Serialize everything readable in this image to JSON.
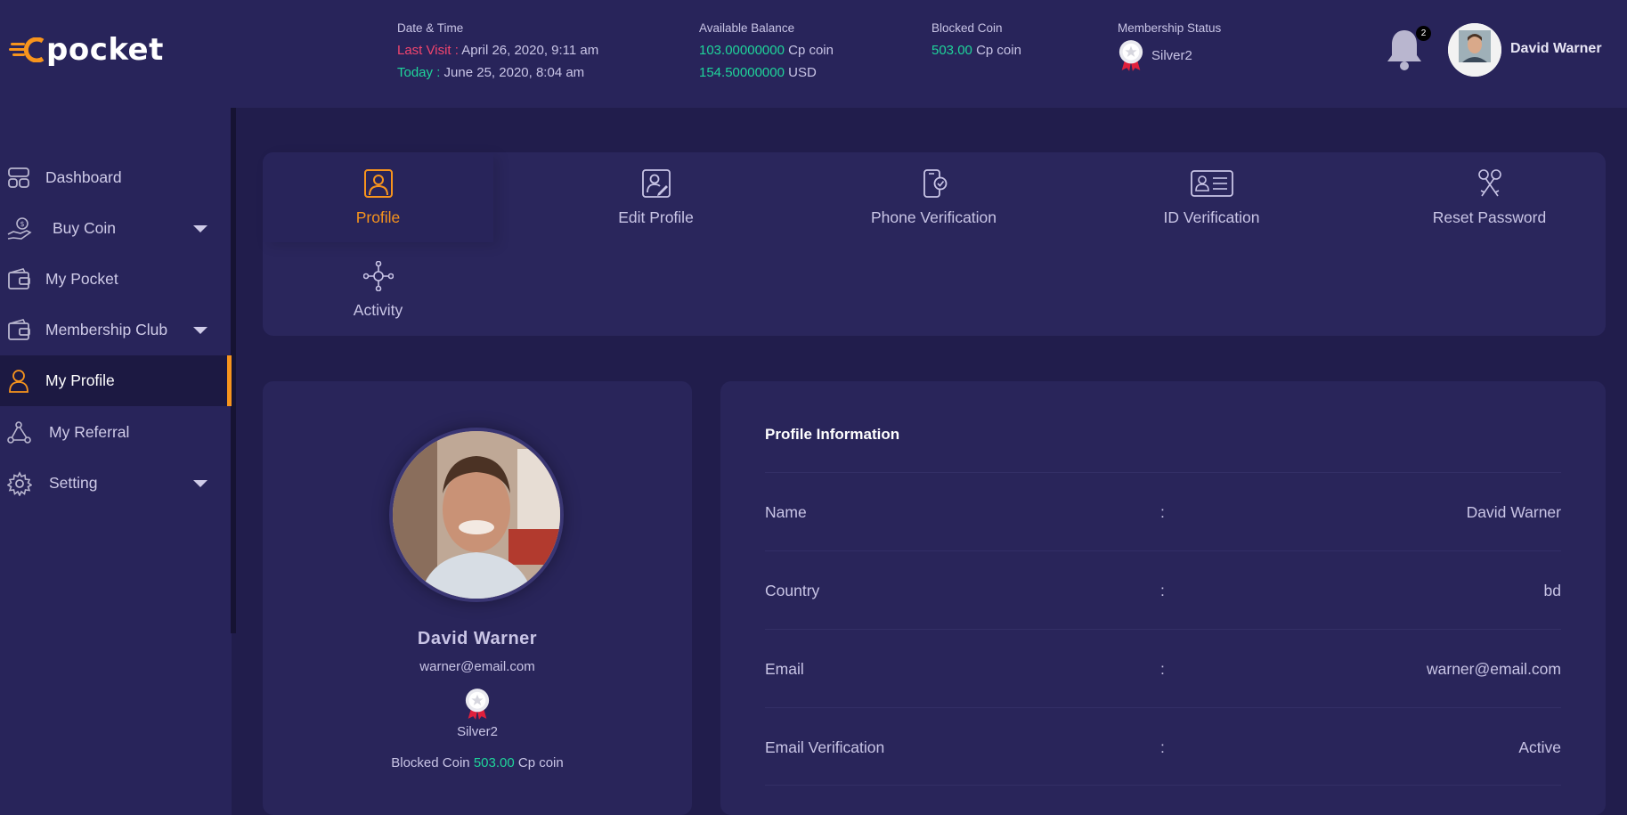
{
  "brand": {
    "logo_text": "pocket",
    "accent": "#f7941d"
  },
  "header": {
    "datetime": {
      "caption": "Date & Time",
      "last_visit_label": "Last Visit :",
      "last_visit_value": "April 26, 2020, 9:11 am",
      "today_label": "Today :",
      "today_value": "June 25, 2020, 8:04 am"
    },
    "balance": {
      "caption": "Available Balance",
      "cp_amount": "103.00000000",
      "cp_unit": "Cp coin",
      "usd_amount": "154.50000000",
      "usd_unit": "USD"
    },
    "blocked": {
      "caption": "Blocked Coin",
      "amount": "503.00",
      "unit": "Cp coin"
    },
    "membership": {
      "caption": "Membership Status",
      "value": "Silver2",
      "icon": "medal-icon"
    },
    "notifications": {
      "count": "2",
      "icon": "bell-icon"
    },
    "user": {
      "name": "David Warner"
    }
  },
  "sidebar": {
    "items": [
      {
        "label": "Dashboard",
        "icon": "dashboard-icon",
        "has_caret": false,
        "active": false
      },
      {
        "label": "Buy Coin",
        "icon": "buy-coin-icon",
        "has_caret": true,
        "active": false
      },
      {
        "label": "My Pocket",
        "icon": "wallet-icon",
        "has_caret": false,
        "active": false
      },
      {
        "label": "Membership Club",
        "icon": "wallet-icon",
        "has_caret": true,
        "active": false
      },
      {
        "label": "My Profile",
        "icon": "user-icon",
        "has_caret": false,
        "active": true
      },
      {
        "label": "My Referral",
        "icon": "share-icon",
        "has_caret": false,
        "active": false
      },
      {
        "label": "Setting",
        "icon": "gear-icon",
        "has_caret": true,
        "active": false
      }
    ]
  },
  "tabs": [
    {
      "label": "Profile",
      "icon": "profile-icon",
      "active": true
    },
    {
      "label": "Edit Profile",
      "icon": "edit-profile-icon",
      "active": false
    },
    {
      "label": "Phone Verification",
      "icon": "phone-verification-icon",
      "active": false
    },
    {
      "label": "ID Verification",
      "icon": "id-card-icon",
      "active": false
    },
    {
      "label": "Reset Password",
      "icon": "keys-icon",
      "active": false
    },
    {
      "label": "Activity",
      "icon": "activity-icon",
      "active": false
    }
  ],
  "profile_card": {
    "name": "David Warner",
    "email": "warner@email.com",
    "rank": "Silver2",
    "blocked_label": "Blocked Coin",
    "blocked_amount": "503.00",
    "blocked_unit": "Cp coin"
  },
  "profile_info": {
    "title": "Profile Information",
    "separator": ":",
    "rows": [
      {
        "key": "Name",
        "value": "David Warner"
      },
      {
        "key": "Country",
        "value": "bd"
      },
      {
        "key": "Email",
        "value": "warner@email.com"
      },
      {
        "key": "Email Verification",
        "value": "Active"
      }
    ]
  },
  "colors": {
    "green": "#1fd49a",
    "red": "#f2456e",
    "panel": "#28245a",
    "background": "#211d4c"
  }
}
